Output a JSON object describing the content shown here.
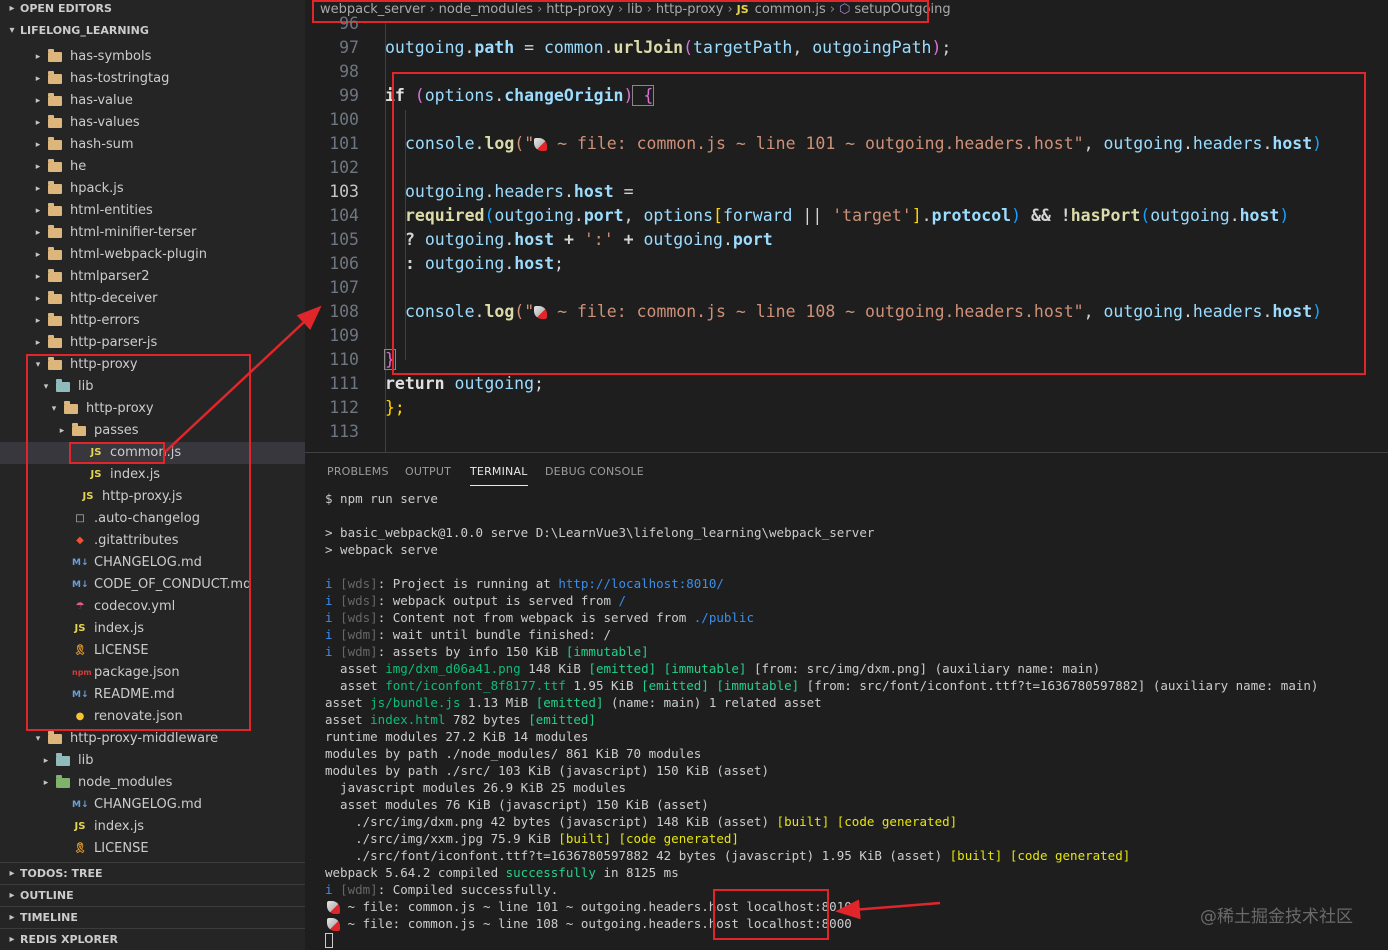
{
  "sidebar": {
    "open_editors": "OPEN EDITORS",
    "workspace": "LIFELONG_LEARNING",
    "items": [
      {
        "label": "has-symbols"
      },
      {
        "label": "has-tostringtag"
      },
      {
        "label": "has-value"
      },
      {
        "label": "has-values"
      },
      {
        "label": "hash-sum"
      },
      {
        "label": "he"
      },
      {
        "label": "hpack.js"
      },
      {
        "label": "html-entities"
      },
      {
        "label": "html-minifier-terser"
      },
      {
        "label": "html-webpack-plugin"
      },
      {
        "label": "htmlparser2"
      },
      {
        "label": "http-deceiver"
      },
      {
        "label": "http-errors"
      },
      {
        "label": "http-parser-js"
      },
      {
        "label": "http-proxy"
      },
      {
        "label": "lib"
      },
      {
        "label": "http-proxy"
      },
      {
        "label": "passes"
      },
      {
        "label": "common.js"
      },
      {
        "label": "index.js"
      },
      {
        "label": "http-proxy.js"
      },
      {
        "label": ".auto-changelog"
      },
      {
        "label": ".gitattributes"
      },
      {
        "label": "CHANGELOG.md"
      },
      {
        "label": "CODE_OF_CONDUCT.md"
      },
      {
        "label": "codecov.yml"
      },
      {
        "label": "index.js"
      },
      {
        "label": "LICENSE"
      },
      {
        "label": "package.json"
      },
      {
        "label": "README.md"
      },
      {
        "label": "renovate.json"
      },
      {
        "label": "http-proxy-middleware"
      },
      {
        "label": "lib"
      },
      {
        "label": "node_modules"
      },
      {
        "label": "CHANGELOG.md"
      },
      {
        "label": "index.js"
      },
      {
        "label": "LICENSE"
      }
    ],
    "sections": {
      "todos": "TODOS: TREE",
      "outline": "OUTLINE",
      "timeline": "TIMELINE",
      "redis": "REDIS XPLORER"
    }
  },
  "breadcrumb": {
    "p1": "webpack_server",
    "p2": "node_modules",
    "p3": "http-proxy",
    "p4": "lib",
    "p5": "http-proxy",
    "js_badge": "JS",
    "file": "common.js",
    "symbol": "setupOutgoing"
  },
  "code": {
    "line_numbers": [
      "96",
      "97",
      "98",
      "99",
      "100",
      "101",
      "102",
      "103",
      "104",
      "105",
      "106",
      "107",
      "108",
      "109",
      "110",
      "111",
      "112",
      "113"
    ],
    "l97": {
      "a": "outgoing",
      "b": ".",
      "c": "path",
      "d": " = ",
      "e": "common",
      "f": ".",
      "g": "urlJoin",
      "h": "(",
      "i": "targetPath",
      "j": ", ",
      "k": "outgoingPath",
      "l": ")",
      "m": ";"
    },
    "l99": {
      "a": "if",
      "b": " (",
      "c": "options",
      "d": ".",
      "e": "changeOrigin",
      "f": ")",
      "g": " {"
    },
    "l101": {
      "a": "console",
      "b": ".",
      "c": "log",
      "d": "(\"",
      "e": " ~ file: common.js ~ line 101 ~ outgoing.headers.host\"",
      "f": ", ",
      "g": "outgoing",
      "h": ".",
      "i": "headers",
      "j": ".",
      "k": "host",
      "l": ")"
    },
    "l103": {
      "a": "outgoing",
      "b": ".",
      "c": "headers",
      "d": ".",
      "e": "host",
      "f": " ="
    },
    "l104": {
      "a": "required",
      "b": "(",
      "c": "outgoing",
      "d": ".",
      "e": "port",
      "f": ", ",
      "g": "options",
      "h": "[",
      "i": "forward",
      "j": " || ",
      "k": "'target'",
      "l": "]",
      "m": ".",
      "n": "protocol",
      "o": ")",
      "p": " && ",
      "q": "!",
      "r": "hasPort",
      "s": "(",
      "t": "outgoing",
      "u": ".",
      "v": "host",
      "w": ")"
    },
    "l105": {
      "a": "? ",
      "b": "outgoing",
      "c": ".",
      "d": "host",
      "e": " + ",
      "f": "':'",
      "g": " + ",
      "h": "outgoing",
      "i": ".",
      "j": "port"
    },
    "l106": {
      "a": ": ",
      "b": "outgoing",
      "c": ".",
      "d": "host",
      "e": ";"
    },
    "l108": {
      "a": "console",
      "b": ".",
      "c": "log",
      "d": "(\"",
      "e": " ~ file: common.js ~ line 108 ~ outgoing.headers.host\"",
      "f": ", ",
      "g": "outgoing",
      "h": ".",
      "i": "headers",
      "j": ".",
      "k": "host",
      "l": ")"
    },
    "l110": {
      "a": "}"
    },
    "l111": {
      "a": "return",
      "b": " outgoing",
      "c": ";"
    },
    "l112": {
      "a": "};"
    }
  },
  "panel": {
    "tabs": [
      "PROBLEMS",
      "OUTPUT",
      "TERMINAL",
      "DEBUG CONSOLE"
    ],
    "active": "TERMINAL"
  },
  "terminal": {
    "t1": "$ npm run serve",
    "t2": "> basic_webpack@1.0.0 serve D:\\LearnVue3\\lifelong_learning\\webpack_server",
    "t3": "> webpack serve",
    "t4a": "i ",
    "t4b": "[wds]",
    "t4c": ": Project is running at ",
    "t4d": "http://localhost:8010/",
    "t5a": "i ",
    "t5b": "[wds]",
    "t5c": ": webpack output is served from ",
    "t5d": "/",
    "t6a": "i ",
    "t6b": "[wds]",
    "t6c": ": Content not from webpack is served from ",
    "t6d": "./public",
    "t7a": "i ",
    "t7b": "[wdm]",
    "t7c": ": wait until bundle finished: /",
    "t8a": "i ",
    "t8b": "[wdm]",
    "t8c": ": assets by info 150 KiB ",
    "t8d": "[immutable]",
    "t9a": "  asset ",
    "t9b": "img/dxm_d06a41.png",
    "t9c": " 148 KiB ",
    "t9d": "[emitted] [immutable]",
    "t9e": " [from: src/img/dxm.png] (auxiliary name: main)",
    "t10a": "  asset ",
    "t10b": "font/iconfont_8f8177.ttf",
    "t10c": " 1.95 KiB ",
    "t10d": "[emitted] [immutable]",
    "t10e": " [from: src/font/iconfont.ttf?t=1636780597882] (auxiliary name: main)",
    "t11a": "asset ",
    "t11b": "js/bundle.js",
    "t11c": " 1.13 MiB ",
    "t11d": "[emitted]",
    "t11e": " (name: main) 1 related asset",
    "t12a": "asset ",
    "t12b": "index.html",
    "t12c": " 782 bytes ",
    "t12d": "[emitted]",
    "t13": "runtime modules 27.2 KiB 14 modules",
    "t14": "modules by path ./node_modules/ 861 KiB 70 modules",
    "t15": "modules by path ./src/ 103 KiB (javascript) 150 KiB (asset)",
    "t16": "  javascript modules 26.9 KiB 25 modules",
    "t17": "  asset modules 76 KiB (javascript) 150 KiB (asset)",
    "t18a": "    ./src/img/dxm.png 42 bytes (javascript) 148 KiB (asset) ",
    "t18b": "[built] [code generated]",
    "t19a": "    ./src/img/xxm.jpg 75.9 KiB ",
    "t19b": "[built] [code generated]",
    "t20a": "    ./src/font/iconfont.ttf?t=1636780597882 42 bytes (javascript) 1.95 KiB (asset) ",
    "t20b": "[built] [code generated]",
    "t21a": "webpack 5.64.2 compiled ",
    "t21b": "successfully",
    "t21c": " in 8125 ms",
    "t22a": "i ",
    "t22b": "[wdm]",
    "t22c": ": Compiled successfully.",
    "t23a": " ~ file: common.js ~ line 101 ~ outgoing.headers.host ",
    "t23b": "localhost:8010",
    "t24a": " ~ file: common.js ~ line 108 ~ outgoing.headers.host ",
    "t24b": "localhost:8000"
  },
  "watermark": "@稀土掘金技术社区",
  "colors": {
    "annotation": "#e0262b",
    "js": "#e8d44d",
    "folder": "#dcb67a"
  }
}
